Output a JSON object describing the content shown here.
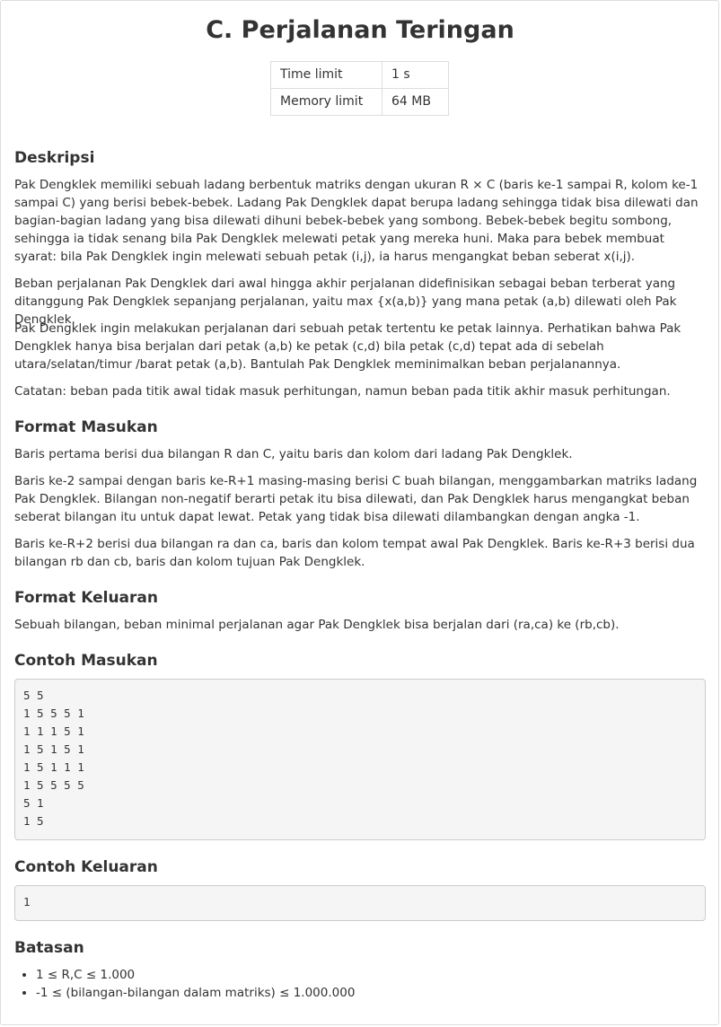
{
  "problem": {
    "title": "C. Perjalanan Teringan",
    "limits": [
      {
        "label": "Time limit",
        "value": "1 s"
      },
      {
        "label": "Memory limit",
        "value": "64 MB"
      }
    ]
  },
  "sections": {
    "description": {
      "heading": "Deskripsi",
      "paragraphs": [
        "Pak Dengklek memiliki sebuah ladang berbentuk matriks dengan ukuran R × C (baris ke-1 sampai R, kolom ke-1 sampai C) yang berisi bebek-bebek. Ladang Pak Dengklek dapat berupa ladang sehingga tidak bisa dilewati dan bagian-bagian ladang yang bisa dilewati dihuni bebek-bebek yang sombong. Bebek-bebek begitu sombong, sehingga ia tidak senang bila Pak Dengklek melewati petak yang mereka huni. Maka para bebek membuat syarat: bila Pak Dengklek ingin melewati sebuah petak (i,j), ia harus mengangkat beban seberat x(i,j).",
        "Beban perjalanan Pak Dengklek dari awal hingga akhir perjalanan didefinisikan sebagai beban terberat yang ditanggung Pak Dengklek sepanjang perjalanan, yaitu max {x(a,b)} yang mana petak (a,b) dilewati oleh Pak Dengklek.",
        "Pak Dengklek ingin melakukan perjalanan dari sebuah petak tertentu ke petak lainnya. Perhatikan bahwa Pak Dengklek hanya bisa berjalan dari petak (a,b) ke petak (c,d) bila petak (c,d) tepat ada di sebelah utara/selatan/timur /barat petak (a,b). Bantulah Pak Dengklek meminimalkan beban perjalanannya.",
        "Catatan: beban pada titik awal tidak masuk perhitungan, namun beban pada titik akhir masuk perhitungan."
      ]
    },
    "input_format": {
      "heading": "Format Masukan",
      "paragraphs": [
        "Baris pertama berisi dua bilangan R dan C, yaitu baris dan kolom dari ladang Pak Dengklek.",
        "Baris ke-2 sampai dengan baris ke-R+1 masing-masing berisi C buah bilangan, menggambarkan matriks ladang Pak Dengklek. Bilangan non-negatif berarti petak itu bisa dilewati, dan Pak Dengklek harus mengangkat beban seberat bilangan itu untuk dapat lewat. Petak yang tidak bisa dilewati dilambangkan dengan angka -1.",
        "Baris ke-R+2 berisi dua bilangan ra dan ca, baris dan kolom tempat awal Pak Dengklek. Baris ke-R+3 berisi dua bilangan rb dan cb, baris dan kolom tujuan Pak Dengklek."
      ]
    },
    "output_format": {
      "heading": "Format Keluaran",
      "paragraphs": [
        "Sebuah bilangan, beban minimal perjalanan agar Pak Dengklek bisa berjalan dari (ra,ca) ke (rb,cb)."
      ]
    },
    "sample_input": {
      "heading": "Contoh Masukan",
      "code": "5 5\n1 5 5 5 1\n1 1 1 5 1\n1 5 1 5 1\n1 5 1 1 1\n1 5 5 5 5\n5 1\n1 5"
    },
    "sample_output": {
      "heading": "Contoh Keluaran",
      "code": "1"
    },
    "constraints": {
      "heading": "Batasan",
      "items": [
        "1 ≤ R,C ≤ 1.000",
        "-1 ≤ (bilangan-bilangan dalam matriks) ≤ 1.000.000"
      ]
    }
  }
}
